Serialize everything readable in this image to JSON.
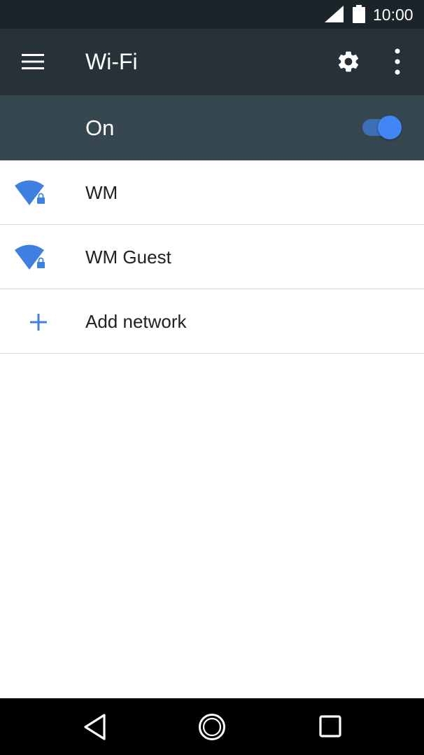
{
  "status_bar": {
    "time": "10:00",
    "signal_icon": "cell-signal-icon",
    "battery_icon": "battery-icon"
  },
  "app_bar": {
    "menu_icon": "hamburger-menu-icon",
    "title": "Wi-Fi",
    "settings_icon": "gear-icon",
    "overflow_icon": "overflow-menu-icon"
  },
  "wifi_toggle": {
    "label": "On",
    "state": true
  },
  "networks": [
    {
      "name": "WM",
      "icon": "wifi-locked-icon"
    },
    {
      "name": "WM Guest",
      "icon": "wifi-locked-icon"
    }
  ],
  "add_network": {
    "label": "Add network",
    "icon": "plus-icon"
  },
  "nav_bar": {
    "back_icon": "back-icon",
    "home_icon": "home-icon",
    "recents_icon": "recents-icon"
  },
  "colors": {
    "status_bar_bg": "#1b2429",
    "app_bar_bg": "#263238",
    "toggle_bar_bg": "#37474f",
    "accent": "#4285f4",
    "wifi_icon": "#3f7fe0",
    "divider": "#d9d9d9"
  }
}
